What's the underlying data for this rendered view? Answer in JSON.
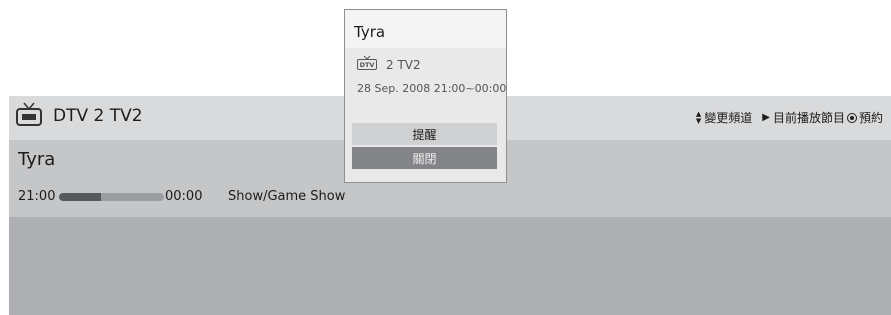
{
  "header": {
    "channel": "DTV 2  TV2",
    "hints": [
      {
        "icon": "updown-arrows-icon",
        "label": "變更頻道"
      },
      {
        "icon": "play-triangle-icon",
        "label": "目前播放節目"
      },
      {
        "icon": "record-icon",
        "label": "預約"
      }
    ]
  },
  "program": {
    "title": "Tyra",
    "start": "21:00",
    "end": "00:00",
    "progress": 0.4,
    "genre": "Show/Game Show"
  },
  "popup": {
    "title": "Tyra",
    "channel": "2 TV2",
    "badge": "DTV",
    "datetime": "28 Sep. 2008 21:00~00:00",
    "buttons": {
      "remind": "提醒",
      "close": "關閉"
    }
  },
  "colors": {
    "info_bar": "#c5c6c8",
    "top_strip": "#d9dadb",
    "lower_panel": "#adafb2",
    "popup_bg": "#eeeeee",
    "close_button": "#838487"
  }
}
